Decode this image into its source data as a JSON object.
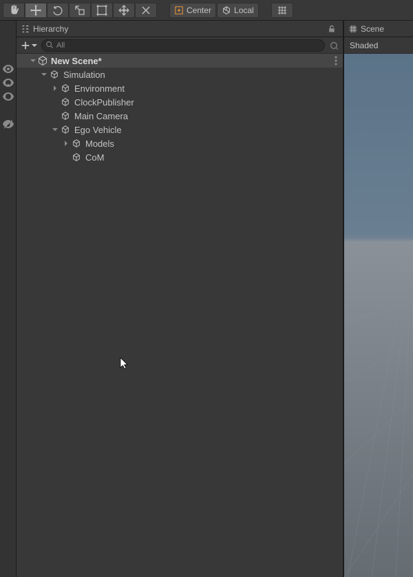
{
  "toolbar": {
    "center_label": "Center",
    "local_label": "Local"
  },
  "hierarchy": {
    "tab_label": "Hierarchy",
    "search_placeholder": "All",
    "scene_name": "New Scene*",
    "nodes": {
      "simulation": "Simulation",
      "environment": "Environment",
      "clock_publisher": "ClockPublisher",
      "main_camera": "Main Camera",
      "ego_vehicle": "Ego Vehicle",
      "models": "Models",
      "com": "CoM"
    }
  },
  "scene": {
    "tab_label": "Scene",
    "shading_label": "Shaded"
  }
}
